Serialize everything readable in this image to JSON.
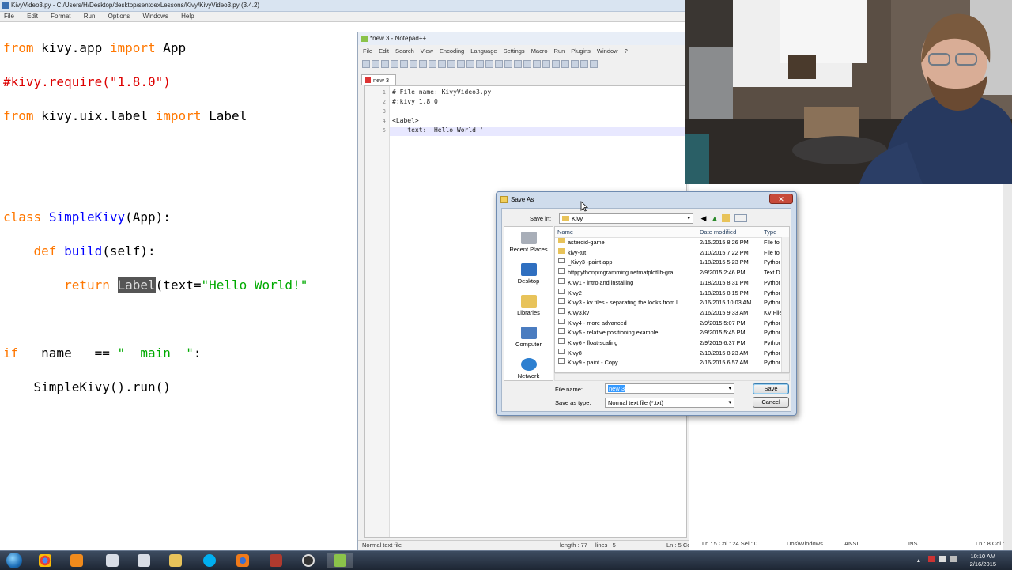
{
  "idle": {
    "title": "KivyVideo3.py - C:/Users/H/Desktop/desktop/sentdexLessons/Kivy/KivyVideo3.py (3.4.2)",
    "menu": [
      "File",
      "Edit",
      "Format",
      "Run",
      "Options",
      "Windows",
      "Help"
    ],
    "code": {
      "l1": {
        "a": "from",
        "b": " kivy.app ",
        "c": "import",
        "d": " App"
      },
      "l2": "#kivy.require(\"1.8.0\")",
      "l3": {
        "a": "from",
        "b": " kivy.uix.label ",
        "c": "import",
        "d": " Label"
      },
      "l6": {
        "a": "class",
        "b": " ",
        "c": "SimpleKivy",
        "d": "(App):"
      },
      "l7": {
        "a": "    ",
        "b": "def",
        "c": " ",
        "d": "build",
        "e": "(self):"
      },
      "l8": {
        "a": "        ",
        "b": "return",
        "c": " ",
        "d": "Label",
        "e": "(text=",
        "f": "\"Hello World!\""
      },
      "l10": {
        "a": "if",
        "b": " __name__ == ",
        "c": "\"__main__\"",
        "d": ":"
      },
      "l11": "    SimpleKivy().run()"
    }
  },
  "notepad": {
    "title": "*new 3 - Notepad++",
    "menu": [
      "File",
      "Edit",
      "Search",
      "View",
      "Encoding",
      "Language",
      "Settings",
      "Macro",
      "Run",
      "Plugins",
      "Window",
      "?"
    ],
    "tab": "new 3",
    "line_numbers": [
      "1",
      "2",
      "3",
      "4",
      "5"
    ],
    "lines": [
      "# File name: KivyVideo3.py",
      "#:kivy 1.8.0",
      "",
      "<Label>",
      "    text: 'Hello World!'"
    ],
    "status": {
      "type": "Normal text file",
      "length": "length : 77",
      "lines": "lines : 5",
      "pos": "Ln : 5    Col : 24    Sel : 0",
      "eol": "Dos\\Windows",
      "enc": "ANSI",
      "ins": "INS"
    },
    "status2": "Ln : 8    Col : 15"
  },
  "dialog": {
    "title": "Save As",
    "close": "✕",
    "save_in_label": "Save in:",
    "save_in_value": "Kivy",
    "places": [
      "Recent Places",
      "Desktop",
      "Libraries",
      "Computer",
      "Network"
    ],
    "columns": {
      "name": "Name",
      "date": "Date modified",
      "type": "Type"
    },
    "files": [
      {
        "name": "asteroid-game",
        "date": "2/15/2015 8:26 PM",
        "type": "File fol",
        "kind": "folder"
      },
      {
        "name": "kivy-tut",
        "date": "2/10/2015 7:22 PM",
        "type": "File fol",
        "kind": "folder"
      },
      {
        "name": "_Kivy3 -paint app",
        "date": "1/18/2015 5:23 PM",
        "type": "Pythor",
        "kind": "file"
      },
      {
        "name": "httppythonprogramming.netmatplotlib-gra...",
        "date": "2/9/2015 2:46 PM",
        "type": "Text D",
        "kind": "file"
      },
      {
        "name": "Kivy1 - intro and installing",
        "date": "1/18/2015 8:31 PM",
        "type": "Pythor",
        "kind": "file"
      },
      {
        "name": "Kivy2",
        "date": "1/18/2015 8:15 PM",
        "type": "Pythor",
        "kind": "file"
      },
      {
        "name": "Kivy3 - kv files - separating the looks from l...",
        "date": "2/16/2015 10:03 AM",
        "type": "Pythor",
        "kind": "file"
      },
      {
        "name": "Kivy3.kv",
        "date": "2/16/2015 9:33 AM",
        "type": "KV File",
        "kind": "file"
      },
      {
        "name": "Kivy4 - more advanced",
        "date": "2/9/2015 5:07 PM",
        "type": "Pythor",
        "kind": "file"
      },
      {
        "name": "Kivy5 - relative positioning example",
        "date": "2/9/2015 5:45 PM",
        "type": "Pythor",
        "kind": "file"
      },
      {
        "name": "Kivy6 - float-scaling",
        "date": "2/9/2015 6:37 PM",
        "type": "Pythor",
        "kind": "file"
      },
      {
        "name": "Kivy8",
        "date": "2/10/2015 8:23 AM",
        "type": "Pythor",
        "kind": "file"
      },
      {
        "name": "Kivy9 - paint - Copy",
        "date": "2/16/2015 6:57 AM",
        "type": "Pythor",
        "kind": "file"
      }
    ],
    "file_name_label": "File name:",
    "file_name_value": "new 3",
    "save_type_label": "Save as type:",
    "save_type_value": "Normal text file (*.txt)",
    "save_button": "Save",
    "cancel_button": "Cancel"
  },
  "taskbar": {
    "time": "10:10 AM",
    "date": "2/16/2015"
  },
  "colors": {
    "keyword": "#ff7700",
    "comment": "#dd0000",
    "string": "#00aa00",
    "def_name": "#0000ff",
    "builtin": "#900090"
  }
}
